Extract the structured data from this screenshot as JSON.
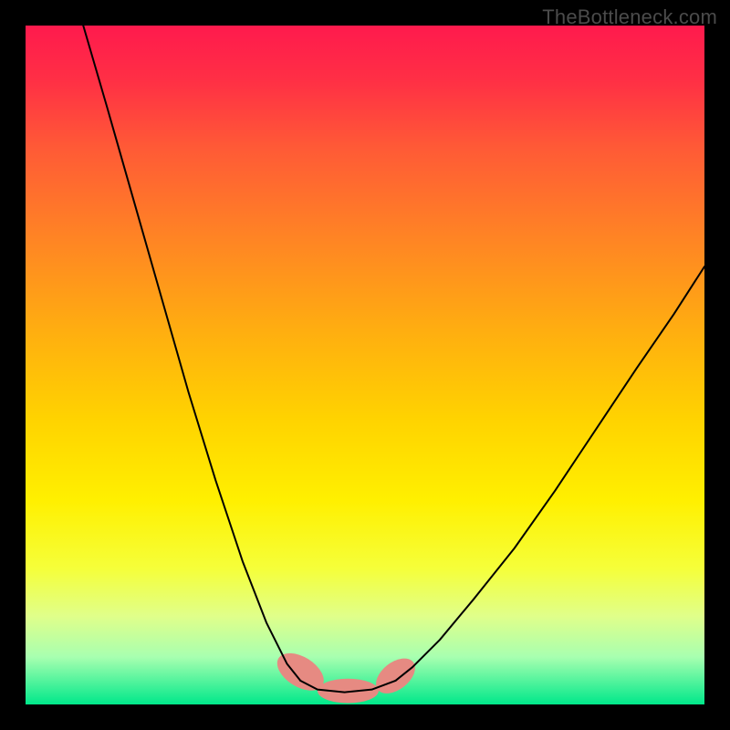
{
  "watermark": "TheBottleneck.com",
  "gradient": {
    "stops": [
      {
        "offset": 0.0,
        "color": "#ff1a4d"
      },
      {
        "offset": 0.08,
        "color": "#ff2f45"
      },
      {
        "offset": 0.18,
        "color": "#ff5a36"
      },
      {
        "offset": 0.3,
        "color": "#ff8026"
      },
      {
        "offset": 0.45,
        "color": "#ffae10"
      },
      {
        "offset": 0.58,
        "color": "#ffd300"
      },
      {
        "offset": 0.7,
        "color": "#fff000"
      },
      {
        "offset": 0.8,
        "color": "#f5ff3a"
      },
      {
        "offset": 0.87,
        "color": "#e0ff8a"
      },
      {
        "offset": 0.93,
        "color": "#a8ffb0"
      },
      {
        "offset": 1.0,
        "color": "#00e88a"
      }
    ]
  },
  "chart_data": {
    "type": "line",
    "title": "",
    "xlabel": "",
    "ylabel": "",
    "xlim": [
      0,
      1
    ],
    "ylim": [
      0,
      1
    ],
    "series": [
      {
        "name": "curve-left",
        "x": [
          0.085,
          0.12,
          0.16,
          0.2,
          0.24,
          0.28,
          0.32,
          0.355,
          0.385,
          0.405
        ],
        "y": [
          1.0,
          0.88,
          0.74,
          0.6,
          0.46,
          0.33,
          0.21,
          0.12,
          0.06,
          0.035
        ],
        "stroke": "#000000",
        "width": 2
      },
      {
        "name": "curve-right",
        "x": [
          0.545,
          0.57,
          0.61,
          0.66,
          0.72,
          0.78,
          0.84,
          0.9,
          0.955,
          1.0
        ],
        "y": [
          0.035,
          0.055,
          0.095,
          0.155,
          0.23,
          0.315,
          0.405,
          0.495,
          0.575,
          0.645
        ],
        "stroke": "#000000",
        "width": 2
      },
      {
        "name": "valley-floor",
        "x": [
          0.405,
          0.43,
          0.47,
          0.51,
          0.545
        ],
        "y": [
          0.035,
          0.022,
          0.018,
          0.022,
          0.035
        ],
        "stroke": "#000000",
        "width": 2
      }
    ],
    "markers": [
      {
        "name": "sausage-left",
        "cx": 0.405,
        "cy": 0.048,
        "rx": 0.022,
        "ry": 0.038,
        "rotate_deg": -58,
        "fill": "#e68a82"
      },
      {
        "name": "sausage-mid",
        "cx": 0.475,
        "cy": 0.02,
        "rx": 0.045,
        "ry": 0.018,
        "rotate_deg": 0,
        "fill": "#e68a82"
      },
      {
        "name": "sausage-right",
        "cx": 0.545,
        "cy": 0.042,
        "rx": 0.02,
        "ry": 0.033,
        "rotate_deg": 52,
        "fill": "#e68a82"
      }
    ]
  }
}
